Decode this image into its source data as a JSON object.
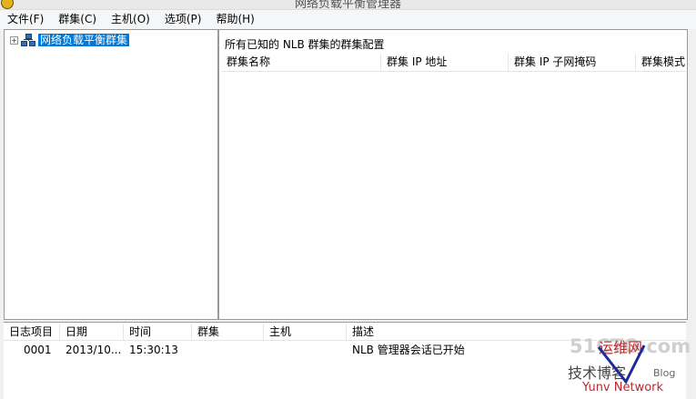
{
  "window": {
    "title": "网络负载平衡管理器"
  },
  "menu": {
    "items": [
      "文件(F)",
      "群集(C)",
      "主机(O)",
      "选项(P)",
      "帮助(H)"
    ]
  },
  "tree": {
    "root_label": "网络负载平衡群集"
  },
  "detail": {
    "caption": "所有已知的 NLB 群集的群集配置",
    "columns": [
      "群集名称",
      "群集 IP 地址",
      "群集 IP 子网掩码",
      "群集模式"
    ]
  },
  "log": {
    "columns": [
      "日志项目",
      "日期",
      "时间",
      "群集",
      "主机",
      "描述"
    ],
    "rows": [
      {
        "entry": "0001",
        "date": "2013/10...",
        "time": "15:30:13",
        "cluster": "",
        "host": "",
        "description": "NLB 管理器会话已开始"
      }
    ]
  },
  "watermark": {
    "line1": "51CTO.com",
    "line2": "技术博客",
    "line3": "Blog",
    "yun": "运维网",
    "network": "Yunv Network"
  }
}
